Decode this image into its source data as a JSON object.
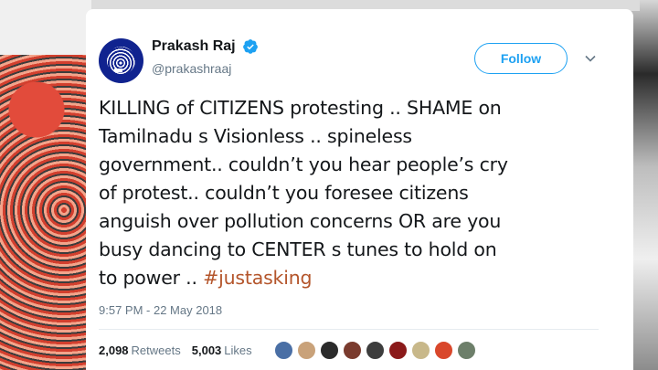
{
  "tweet": {
    "author_name": "Prakash Raj",
    "handle": "@prakashraaj",
    "follow_label": "Follow",
    "text_lines": [
      "KILLING of CITIZENS protesting .. SHAME on",
      "Tamilnadu s Visionless .. spineless",
      "government.. couldn’t you hear people’s cry",
      "of protest.. couldn’t you foresee citizens",
      "anguish over pollution concerns OR are you",
      "busy dancing to CENTER s tunes to hold on",
      "to power .. "
    ],
    "hashtag": "#justasking",
    "timestamp": "9:57 PM - 22 May 2018",
    "retweets_count": "2,098",
    "retweets_label": "Retweets",
    "likes_count": "5,003",
    "likes_label": "Likes"
  },
  "colors": {
    "accent": "#1da1f2",
    "hashtag": "#b4552b",
    "avatar_bg": "#10238f"
  },
  "icons": {
    "verified": "verified-badge-icon",
    "caret": "chevron-down-icon"
  },
  "likers": [
    {
      "color": "#4a6fa5"
    },
    {
      "color": "#c9a27a"
    },
    {
      "color": "#2b2b2b"
    },
    {
      "color": "#7a3b2e"
    },
    {
      "color": "#3d3d3d"
    },
    {
      "color": "#8b1a1a"
    },
    {
      "color": "#c8b88a"
    },
    {
      "color": "#d9472b"
    },
    {
      "color": "#6d7f6a"
    }
  ]
}
